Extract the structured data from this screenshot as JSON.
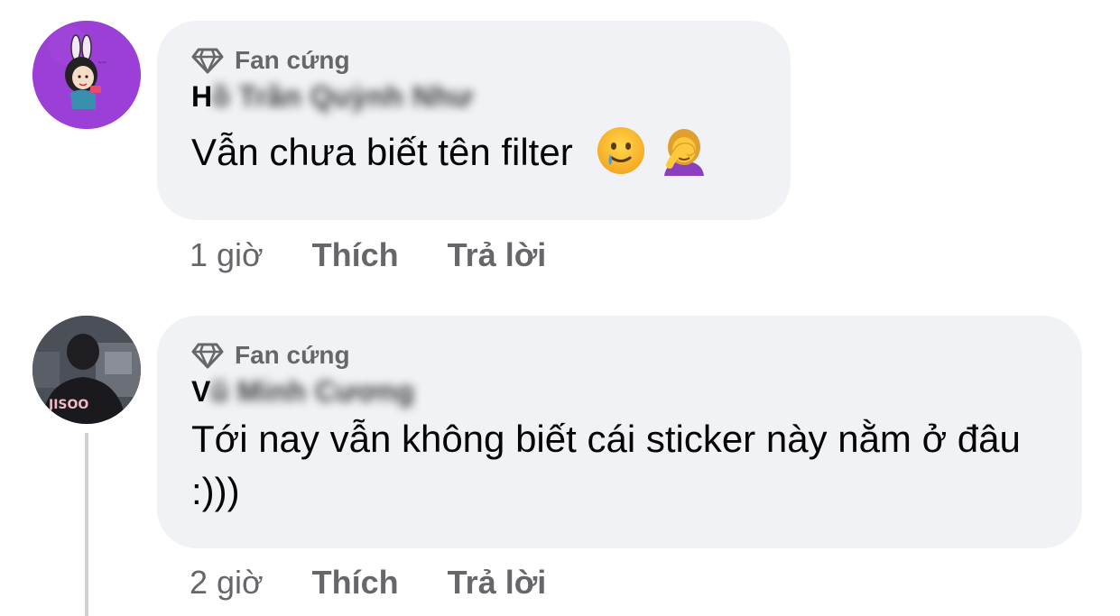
{
  "comments": [
    {
      "badge": "Fan cứng",
      "author_visible": "H",
      "author_blurred": "ồ Trần Quỳnh Như",
      "text": "Vẫn chưa biết tên filter",
      "emojis": [
        "smiling-face-with-tear",
        "woman-facepalming"
      ],
      "time": "1 giờ",
      "like_label": "Thích",
      "reply_label": "Trả lời",
      "avatar": "cartoon-character-avatar",
      "avatar_color": "#9b3fd6"
    },
    {
      "badge": "Fan cứng",
      "author_visible": "V",
      "author_blurred": "ũ Minh Cương",
      "text": "Tới nay vẫn không biết cái sticker này nằm ở đâu :)))",
      "time": "2 giờ",
      "like_label": "Thích",
      "reply_label": "Trả lời",
      "avatar": "person-photo-avatar",
      "avatar_shirt_text": "JISOO"
    }
  ],
  "colors": {
    "bubble": "#f0f2f5",
    "secondary_text": "#65676b",
    "primary_text": "#050505",
    "thread_line": "#ced0d4"
  }
}
